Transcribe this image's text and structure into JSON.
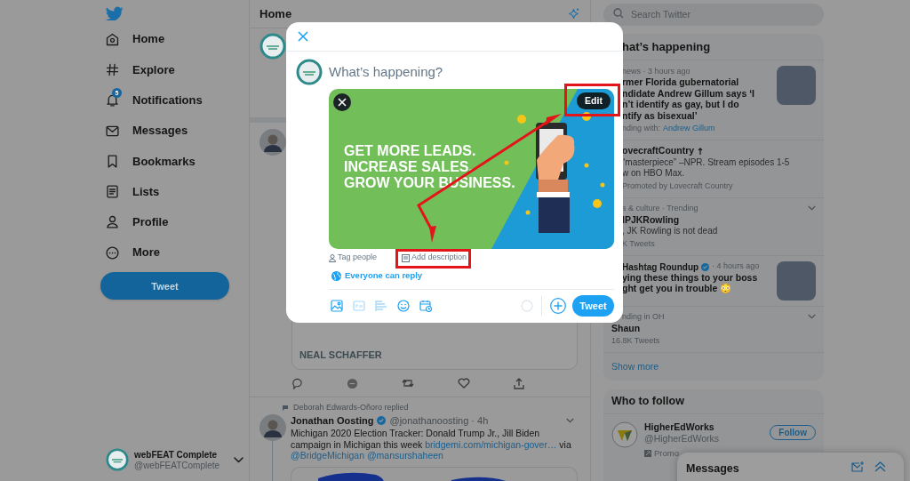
{
  "sidebar": {
    "nav": [
      {
        "label": "Home",
        "kind": "home"
      },
      {
        "label": "Explore",
        "kind": "explore"
      },
      {
        "label": "Notifications",
        "kind": "notifications",
        "badge": "5"
      },
      {
        "label": "Messages",
        "kind": "messages"
      },
      {
        "label": "Bookmarks",
        "kind": "bookmarks"
      },
      {
        "label": "Lists",
        "kind": "lists"
      },
      {
        "label": "Profile",
        "kind": "profile"
      },
      {
        "label": "More",
        "kind": "more"
      }
    ],
    "tweet_button": "Tweet",
    "account": {
      "name": "webFEAT Complete",
      "handle": "@webFEATComplete"
    }
  },
  "timeline": {
    "title": "Home",
    "card_caption": "NEAL SCHAFFER",
    "reply": {
      "context": "Deborah Edwards-Oñoro replied",
      "author": "Jonathan Oosting",
      "verified": true,
      "handle": "@jonathanoosting",
      "time": "· 4h",
      "body": [
        {
          "kind": "text",
          "text": "Michigan 2020 Election Tracker: Donald Trump Jr., Jill Biden campaign in Michigan this week"
        },
        {
          "kind": "link",
          "text": "bridgemi.com/michigan-gover…"
        },
        {
          "kind": "text",
          "text": "via"
        },
        {
          "kind": "link",
          "text": "@BridgeMichigan"
        },
        {
          "kind": "link",
          "text": "@mansurshaheen"
        }
      ]
    }
  },
  "search": {
    "placeholder": "Search Twitter"
  },
  "trends": {
    "title": "hat’s happening",
    "items": [
      {
        "kind": "news",
        "context": "news · 3 hours ago",
        "title_lines": [
          "rmer Florida gubernatorial",
          "ndidate Andrew Gillum says ‘I",
          "n’t identify as gay, but I do",
          "ntify as bisexual’"
        ],
        "footer": "nding with:",
        "footer_link": "Andrew Gillum",
        "thumbnail": true
      },
      {
        "kind": "promoted",
        "title_lines": [
          "ovecraftCountry"
        ],
        "text_lines": [
          "“masterpiece” –NPR. Stream episodes 1-5",
          "w on HBO Max."
        ],
        "footer": "Promoted by Lovecraft Country",
        "thumbnail": false
      },
      {
        "kind": "trend",
        "context": "s & culture · Trending",
        "title_lines": [
          "IPJKRowling"
        ],
        "text_lines": [
          ", JK Rowling is not dead"
        ],
        "footer": "K Tweets",
        "thumbnail": false
      },
      {
        "kind": "moment",
        "source": "Hashtag Roundup",
        "verified": true,
        "context": "· 4 hours ago",
        "title_lines": [
          "ying these things to your boss",
          "ght get you in trouble 😳"
        ],
        "thumbnail": true
      },
      {
        "kind": "trend",
        "context": "nding in OH",
        "title_lines": [
          "Shaun"
        ],
        "footer": "16.8K Tweets",
        "thumbnail": false
      }
    ],
    "show_more": "Show more"
  },
  "who_to_follow": {
    "title": "Who to follow",
    "accounts": [
      {
        "name": "HigherEdWorks",
        "handle": "@HigherEdWorks",
        "button": "Follow",
        "promoted": "Promo"
      }
    ]
  },
  "messages_drawer": {
    "title": "Messages"
  },
  "compose": {
    "placeholder": "What’s happening?",
    "media": {
      "headline": [
        "GET MORE LEADS.",
        "INCREASE SALES.",
        "GROW YOUR BUSINESS."
      ],
      "edit": "Edit"
    },
    "tag_people": "Tag people",
    "add_description": "Add description",
    "reply_setting": "Everyone can reply",
    "tweet_button": "Tweet"
  }
}
